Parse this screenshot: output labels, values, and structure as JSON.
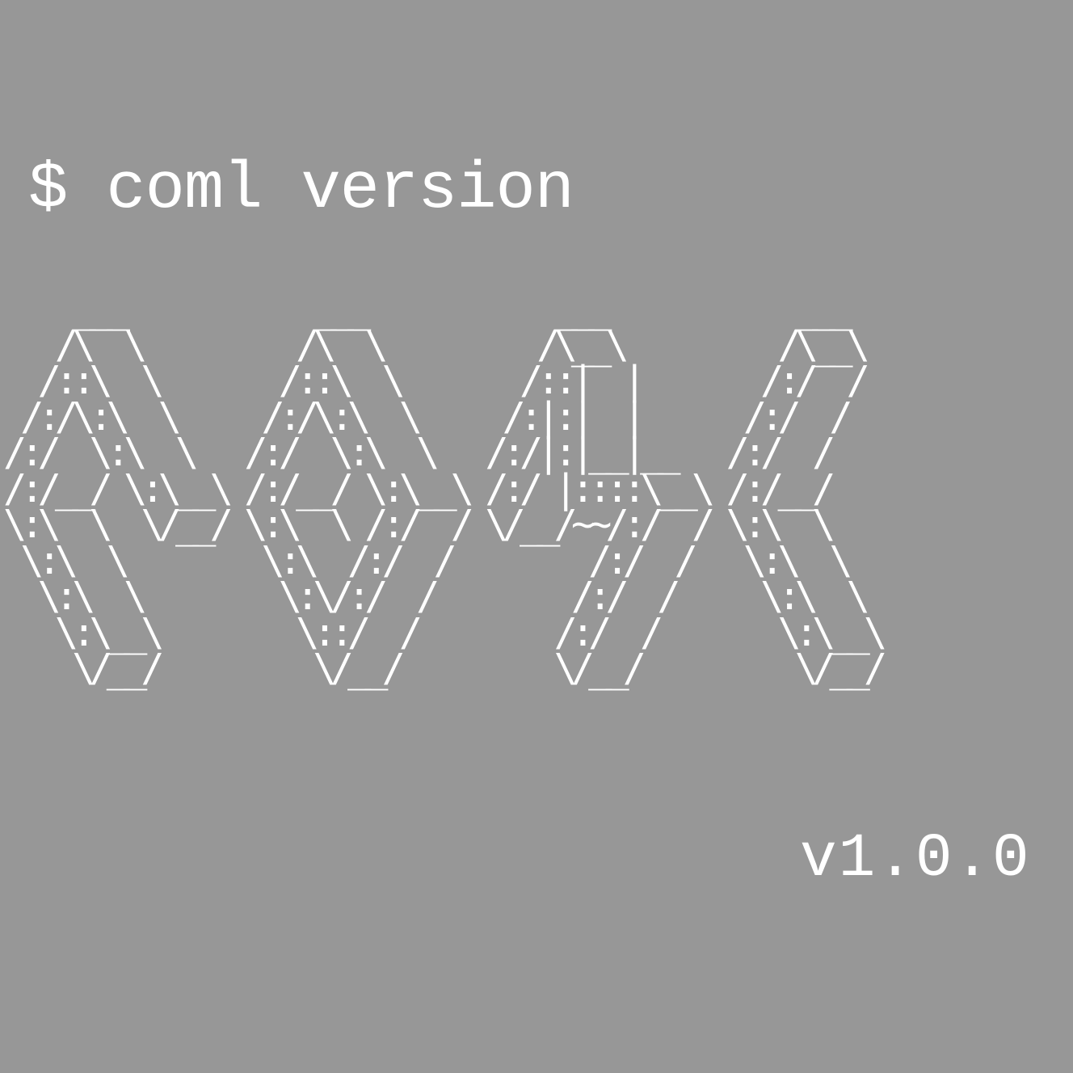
{
  "terminal": {
    "background_color": "#979797",
    "text_color": "#ffffff",
    "command": "$ coml version",
    "logo_ascii": "    ___           ___           ___           ___\n   /\\  \\         /\\  \\         /\\__\\         /\\__\\\n  /::\\  \\       /::\\  \\       /::|  |       /:/  /\n /:/\\:\\  \\     /:/\\:\\  \\     /:|:|  |      /:/  /\n/:/  \\:\\  \\   /:/  \\:\\  \\   /:/|:|__|__   /:/  /\n/:/__/ \\:\\__\\ /:/__/ \\:\\__\\ /:/ |::::\\__\\ /:/__/\n\\:\\  \\  \\/__/ \\:\\  \\ /:/  / \\/__/~~/:/  / \\:\\  \\\n \\:\\  \\        \\:\\  /:/  /        /:/  /   \\:\\  \\\n  \\:\\  \\        \\:\\/:/  /        /:/  /     \\:\\  \\\n   \\:\\__\\        \\::/  /        /:/  /       \\:\\__\\\n    \\/__/         \\/__/         \\/__/         \\/__/",
    "version": "v1.0.0"
  }
}
